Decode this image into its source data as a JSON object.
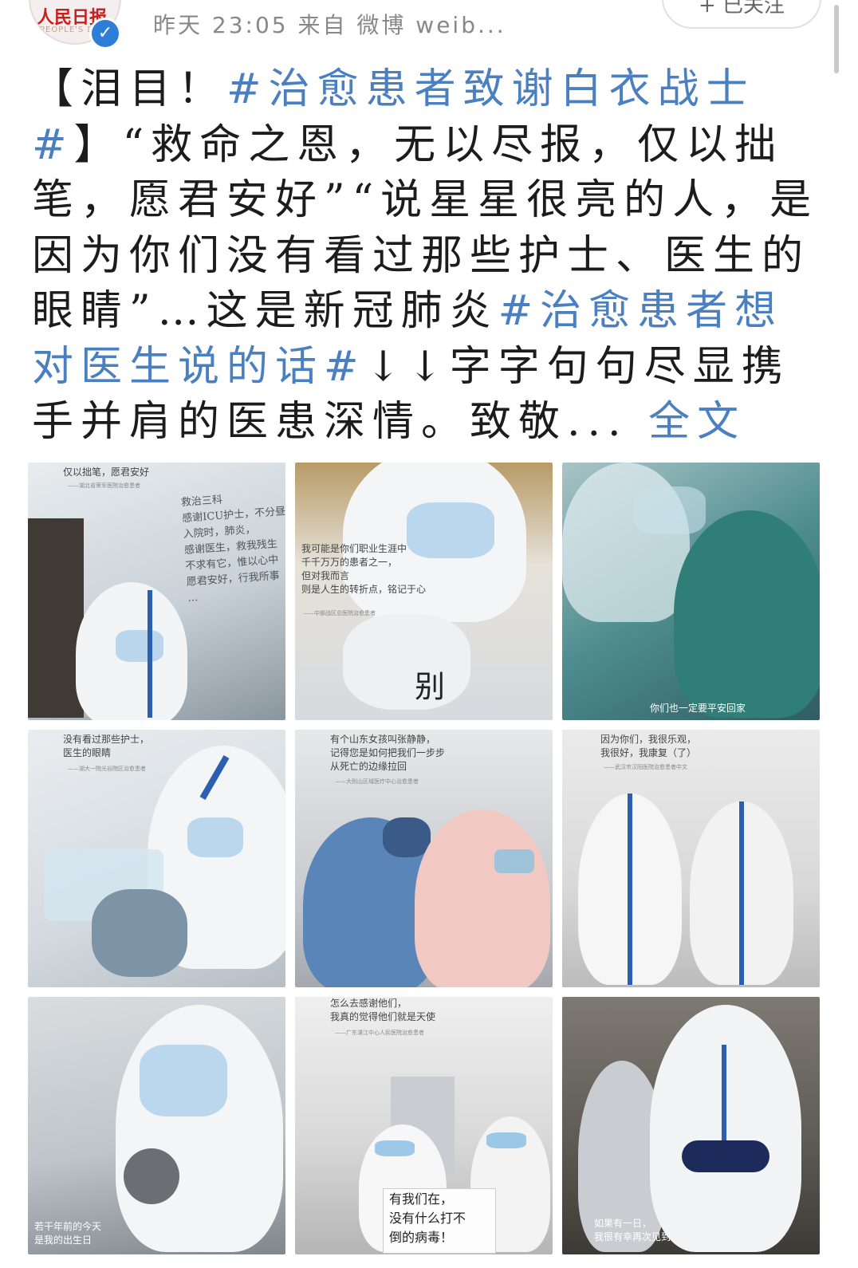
{
  "header": {
    "account_logo_text": "人民日报",
    "account_logo_sub": "PEOPLE'S DAILY",
    "verified_mark": "✓",
    "meta": "昨天 23:05 来自 微博 weib...",
    "follow_label": "+ 已关注"
  },
  "post": {
    "open_bracket": "【",
    "lead": "泪目！",
    "hashtag1": "#治愈患者致谢白衣战士#",
    "close_bracket": "】",
    "body1": "“救命之恩，无以尽报，仅以拙笔，愿君安好”“说星星很亮的人，是因为你们没有看过那些护士、医生的眼睛”…这是新冠肺炎",
    "hashtag2": "#治愈患者想对医生说的话#",
    "body2": "↓↓字字句句尽显携手并肩的医患深情。致敬...",
    "more_label": "全文"
  },
  "images": [
    {
      "quote": "仅以拙笔，愿君安好",
      "source": "——湖北省荣军医院治愈患者",
      "scribble": [
        "救治三科",
        "感谢ICU护士，不分昼夜",
        "入院时，肺炎，",
        "感谢医生，救我残生",
        "不求有它，惟以心中",
        "愿君安好，行我所事",
        "…"
      ]
    },
    {
      "quote": "我可能是你们职业生涯中\n千千万万的患者之一，\n但对我而言\n则是人生的转折点，铭记于心",
      "source": "——中部战区总医院治愈患者",
      "sign": "别"
    },
    {
      "quote": "你们也一定要平安回家"
    },
    {
      "quote": "没有看过那些护士，\n医生的眼睛",
      "source": "——湖大一院光谷院区治愈患者"
    },
    {
      "quote": "有个山东女孩叫张静静，\n记得您是如何把我们一步步\n从死亡的边缘拉回",
      "source": "——大别山区域医疗中心治愈患者"
    },
    {
      "quote": "因为你们，我很乐观，\n我很好，我康复（了）",
      "source": "——武汉市汉阳医院治愈患者中文"
    },
    {
      "quote": "若干年前的今天\n是我的出生日"
    },
    {
      "quote": "怎么去感谢他们，\n我真的觉得他们就是天使",
      "source": "——广东湛江中心人民医院治愈患者",
      "sign": "有我们在，\n没有什么打不\n倒的病毒！"
    },
    {
      "quote": "如果有一日，\n我很有幸再次见到"
    }
  ],
  "colors": {
    "hashtag": "#4a7fc1",
    "verified": "#2e7ed8",
    "text": "#1c1c1c",
    "meta": "#888888"
  }
}
